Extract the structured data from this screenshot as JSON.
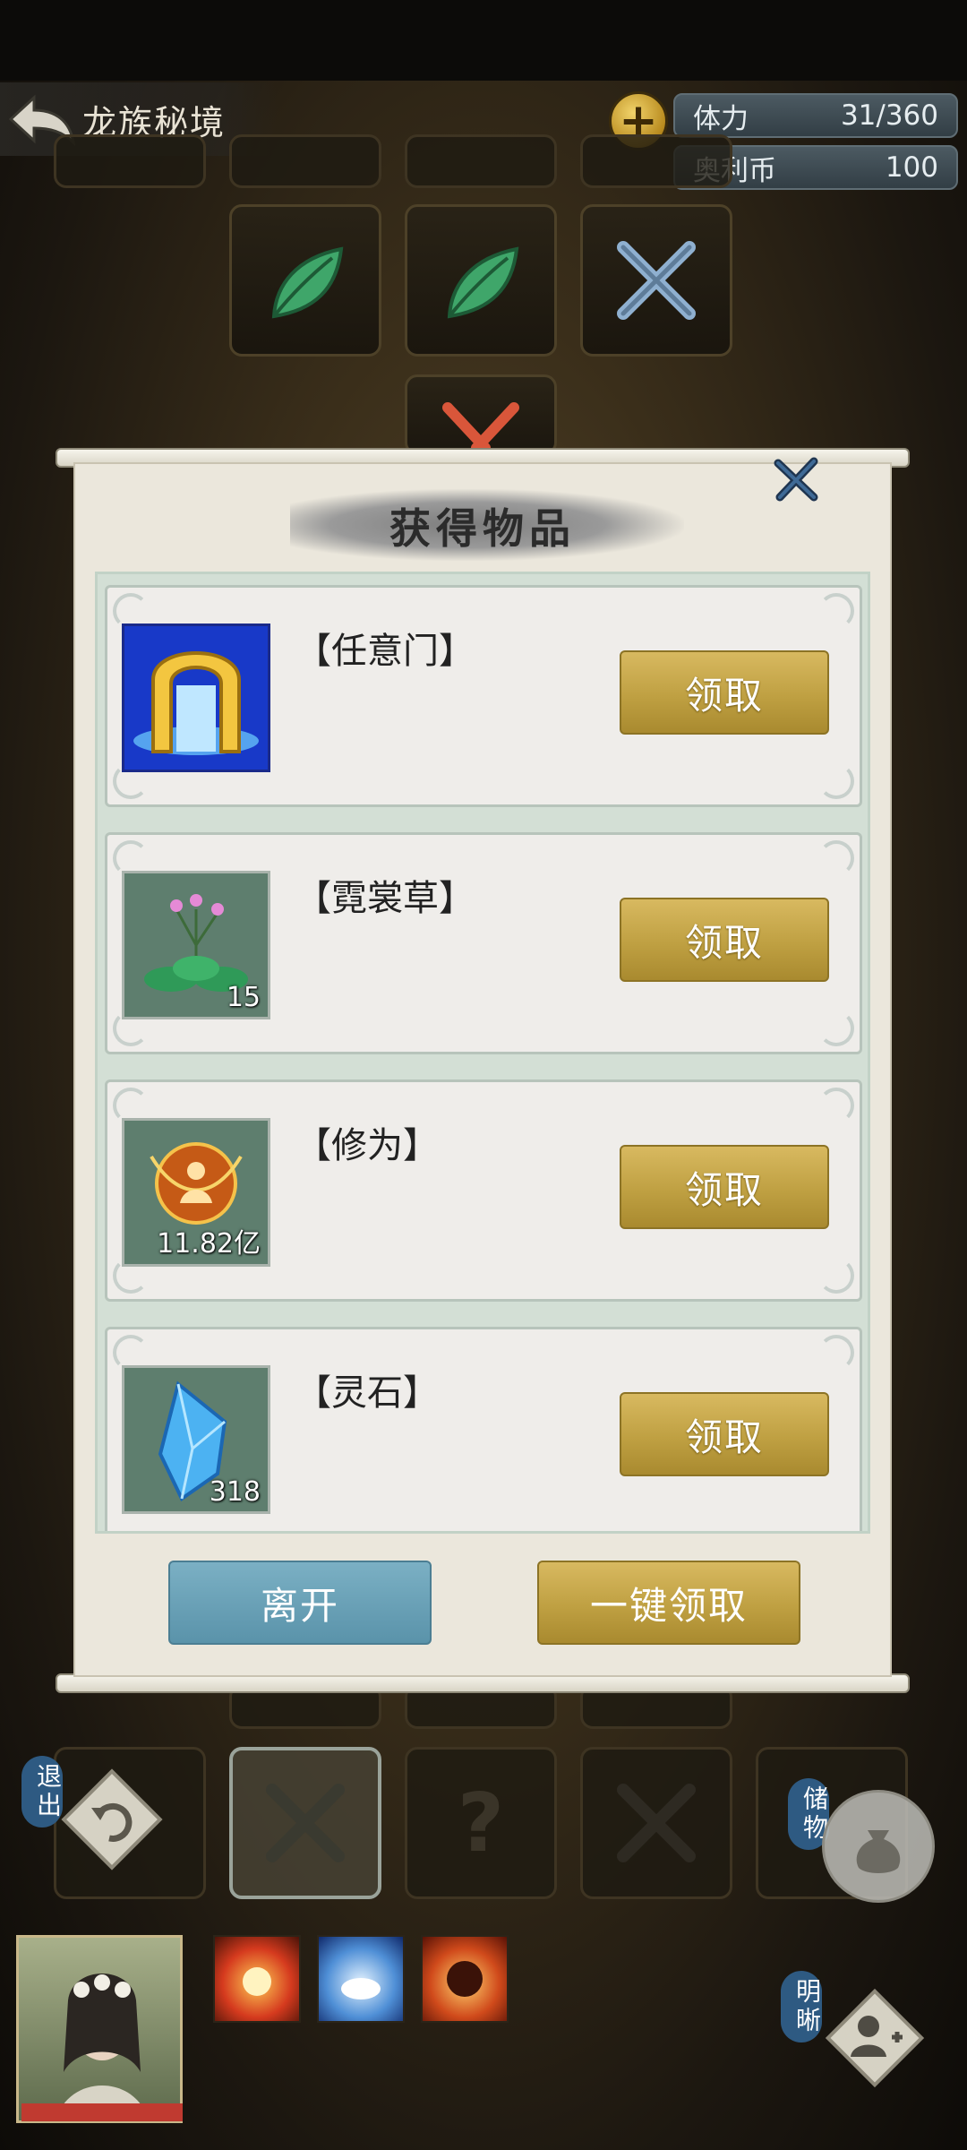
{
  "header": {
    "title": "龙族秘境",
    "back_icon": "back-arrow-icon",
    "plus_label": "+",
    "resources": [
      {
        "name": "体力",
        "value": "31/360"
      },
      {
        "name": "奥利币",
        "value": "100"
      }
    ]
  },
  "dialog": {
    "title": "获得物品",
    "items": [
      {
        "name": "【任意门】",
        "count": "",
        "icon": "golden-gate-icon",
        "claim_label": "领取"
      },
      {
        "name": "【霓裳草】",
        "count": "15",
        "icon": "herb-flower-icon",
        "claim_label": "领取"
      },
      {
        "name": "【修为】",
        "count": "11.82亿",
        "icon": "cultivation-orb-icon",
        "claim_label": "领取"
      },
      {
        "name": "【灵石】",
        "count": "318",
        "icon": "spirit-crystal-icon",
        "claim_label": "领取"
      }
    ],
    "leave_label": "离开",
    "claim_all_label": "一键领取"
  },
  "side_buttons": {
    "exit_label": "退出",
    "storage_label": "储物",
    "clarity_label": "明晰"
  },
  "colors": {
    "gold_button": "#bfa042",
    "blue_button": "#5a93aa",
    "dialog_bg": "#ebe7dc"
  }
}
